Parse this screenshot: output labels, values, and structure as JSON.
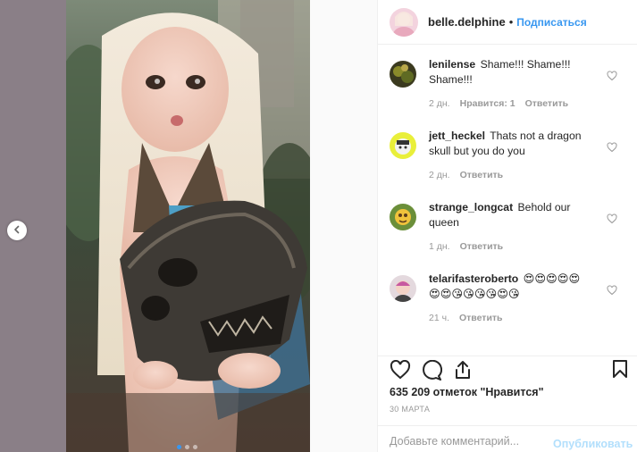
{
  "post": {
    "username": "belle.delphine",
    "follow_label": "Подписаться",
    "likes_text": "635 209 отметок \"Нравится\"",
    "date_text": "30 МАРТА"
  },
  "comments": [
    {
      "user": "lenilense",
      "text": "Shame!!! Shame!!! Shame!!!",
      "time": "2 дн.",
      "likes": "Нравится: 1",
      "reply": "Ответить"
    },
    {
      "user": "jett_heckel",
      "text": "Thats not a dragon skull but you do you",
      "time": "2 дн.",
      "likes": "",
      "reply": "Ответить"
    },
    {
      "user": "strange_longcat",
      "text": "Behold our queen",
      "time": "1 дн.",
      "likes": "",
      "reply": "Ответить"
    },
    {
      "user": "telarifasteroberto",
      "text": "😍😍😍😍😍😍😍😘😘😘😘😍😘",
      "time": "21 ч.",
      "likes": "",
      "reply": "Ответить"
    }
  ],
  "composer": {
    "placeholder": "Добавьте комментарий...",
    "publish_label": "Опубликовать"
  },
  "colors": {
    "accent": "#3897f0",
    "publish_disabled": "#b2dffc",
    "muted": "#999999"
  },
  "icons": [
    "chevron-left-icon",
    "heart-icon",
    "comment-icon",
    "share-icon",
    "bookmark-icon"
  ]
}
